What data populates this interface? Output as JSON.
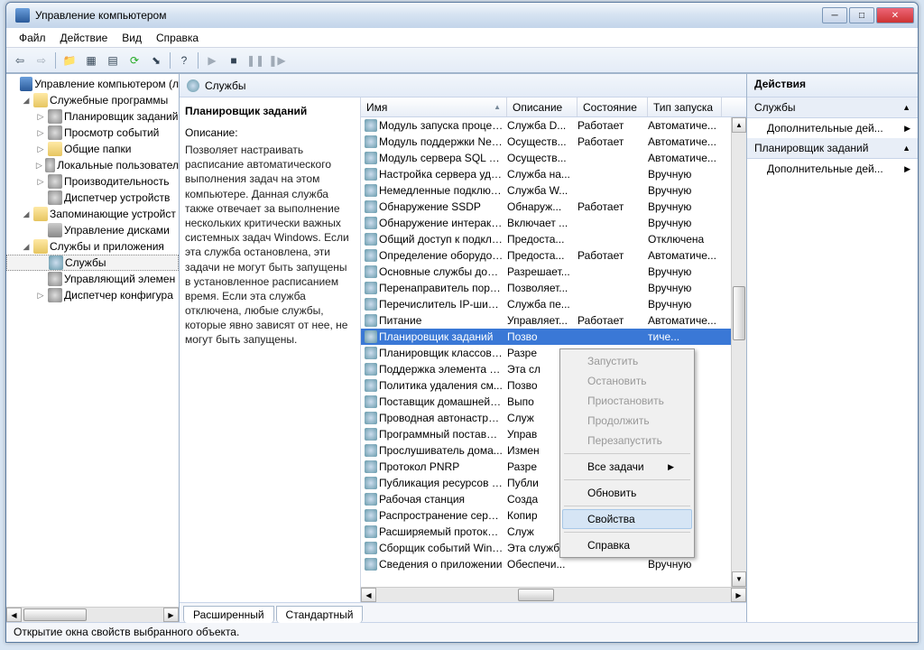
{
  "window": {
    "title": "Управление компьютером"
  },
  "menubar": [
    "Файл",
    "Действие",
    "Вид",
    "Справка"
  ],
  "tree": [
    {
      "d": 0,
      "tw": "",
      "icon": "ic-root",
      "label": "Управление компьютером (л"
    },
    {
      "d": 1,
      "tw": "◢",
      "icon": "ic-fold",
      "label": "Служебные программы"
    },
    {
      "d": 2,
      "tw": "▷",
      "icon": "ic-gear",
      "label": "Планировщик заданий"
    },
    {
      "d": 2,
      "tw": "▷",
      "icon": "ic-gear",
      "label": "Просмотр событий"
    },
    {
      "d": 2,
      "tw": "▷",
      "icon": "ic-fold",
      "label": "Общие папки"
    },
    {
      "d": 2,
      "tw": "▷",
      "icon": "ic-gear",
      "label": "Локальные пользовател"
    },
    {
      "d": 2,
      "tw": "▷",
      "icon": "ic-gear",
      "label": "Производительность"
    },
    {
      "d": 2,
      "tw": "",
      "icon": "ic-gear",
      "label": "Диспетчер устройств"
    },
    {
      "d": 1,
      "tw": "◢",
      "icon": "ic-fold",
      "label": "Запоминающие устройст"
    },
    {
      "d": 2,
      "tw": "",
      "icon": "ic-disk",
      "label": "Управление дисками"
    },
    {
      "d": 1,
      "tw": "◢",
      "icon": "ic-fold",
      "label": "Службы и приложения"
    },
    {
      "d": 2,
      "tw": "",
      "icon": "ic-srv",
      "label": "Службы",
      "sel": true
    },
    {
      "d": 2,
      "tw": "",
      "icon": "ic-gear",
      "label": "Управляющий элемен"
    },
    {
      "d": 2,
      "tw": "▷",
      "icon": "ic-gear",
      "label": "Диспетчер конфигура"
    }
  ],
  "main": {
    "header": "Службы",
    "detail_title": "Планировщик заданий",
    "detail_label": "Описание:",
    "detail_desc": "Позволяет настраивать расписание автоматического выполнения задач на этом компьютере. Данная служба также отвечает за выполнение нескольких критически важных системных задач Windows. Если эта служба остановлена, эти задачи не могут быть запущены в установленное расписанием время. Если эта служба отключена, любые службы, которые явно зависят от нее, не могут быть запущены."
  },
  "columns": {
    "name": "Имя",
    "desc": "Описание",
    "state": "Состояние",
    "start": "Тип запуска"
  },
  "services": [
    {
      "name": "Модуль запуска процесс...",
      "desc": "Служба D...",
      "state": "Работает",
      "start": "Автоматиче..."
    },
    {
      "name": "Модуль поддержки NetB...",
      "desc": "Осуществ...",
      "state": "Работает",
      "start": "Автоматиче..."
    },
    {
      "name": "Модуль сервера SQL Ser...",
      "desc": "Осуществ...",
      "state": "",
      "start": "Автоматиче..."
    },
    {
      "name": "Настройка сервера удал...",
      "desc": "Служба на...",
      "state": "",
      "start": "Вручную"
    },
    {
      "name": "Немедленные подключе...",
      "desc": "Служба W...",
      "state": "",
      "start": "Вручную"
    },
    {
      "name": "Обнаружение SSDP",
      "desc": "Обнаруж...",
      "state": "Работает",
      "start": "Вручную"
    },
    {
      "name": "Обнаружение интеракти...",
      "desc": "Включает ...",
      "state": "",
      "start": "Вручную"
    },
    {
      "name": "Общий доступ к подклю...",
      "desc": "Предоста...",
      "state": "",
      "start": "Отключена"
    },
    {
      "name": "Определение оборудова...",
      "desc": "Предоста...",
      "state": "Работает",
      "start": "Автоматиче..."
    },
    {
      "name": "Основные службы дове...",
      "desc": "Разрешает...",
      "state": "",
      "start": "Вручную"
    },
    {
      "name": "Перенаправитель порто...",
      "desc": "Позволяет...",
      "state": "",
      "start": "Вручную"
    },
    {
      "name": "Перечислитель IP-шин ...",
      "desc": "Служба пе...",
      "state": "",
      "start": "Вручную"
    },
    {
      "name": "Питание",
      "desc": "Управляет...",
      "state": "Работает",
      "start": "Автоматиче..."
    },
    {
      "name": "Планировщик заданий",
      "desc": "Позво",
      "state": "",
      "start": "тиче...",
      "sel": true
    },
    {
      "name": "Планировщик классов ...",
      "desc": "Разре",
      "state": "",
      "start": "атиче..."
    },
    {
      "name": "Поддержка элемента па...",
      "desc": "Эта сл",
      "state": "",
      "start": "ую"
    },
    {
      "name": "Политика удаления см...",
      "desc": "Позво",
      "state": "",
      "start": "ую"
    },
    {
      "name": "Поставщик домашней г...",
      "desc": "Выпо",
      "state": "",
      "start": "ую"
    },
    {
      "name": "Проводная автонастройка",
      "desc": "Служ",
      "state": "",
      "start": "ую"
    },
    {
      "name": "Программный поставщ...",
      "desc": "Управ",
      "state": "",
      "start": "ую"
    },
    {
      "name": "Прослушиватель дома...",
      "desc": "Измен",
      "state": "",
      "start": "ую"
    },
    {
      "name": "Протокол PNRP",
      "desc": "Разре",
      "state": "",
      "start": "ую"
    },
    {
      "name": "Публикация ресурсов о...",
      "desc": "Публи",
      "state": "",
      "start": "ую"
    },
    {
      "name": "Рабочая станция",
      "desc": "Созда",
      "state": "",
      "start": "атиче..."
    },
    {
      "name": "Распространение серти...",
      "desc": "Копир",
      "state": "",
      "start": "ую"
    },
    {
      "name": "Расширяемый протокол...",
      "desc": "Служ",
      "state": "",
      "start": "ую"
    },
    {
      "name": "Сборщик событий Wind...",
      "desc": "Эта служб...",
      "state": "",
      "start": "Вручную"
    },
    {
      "name": "Сведения о приложении",
      "desc": "Обеспечи...",
      "state": "",
      "start": "Вручную"
    }
  ],
  "tabs": {
    "extended": "Расширенный",
    "standard": "Стандартный"
  },
  "actions": {
    "header": "Действия",
    "sec1": "Службы",
    "item1": "Дополнительные дей...",
    "sec2": "Планировщик заданий",
    "item2": "Дополнительные дей..."
  },
  "context": {
    "start": "Запустить",
    "stop": "Остановить",
    "pause": "Приостановить",
    "resume": "Продолжить",
    "restart": "Перезапустить",
    "alltasks": "Все задачи",
    "refresh": "Обновить",
    "props": "Свойства",
    "help": "Справка"
  },
  "status": "Открытие окна свойств выбранного объекта."
}
